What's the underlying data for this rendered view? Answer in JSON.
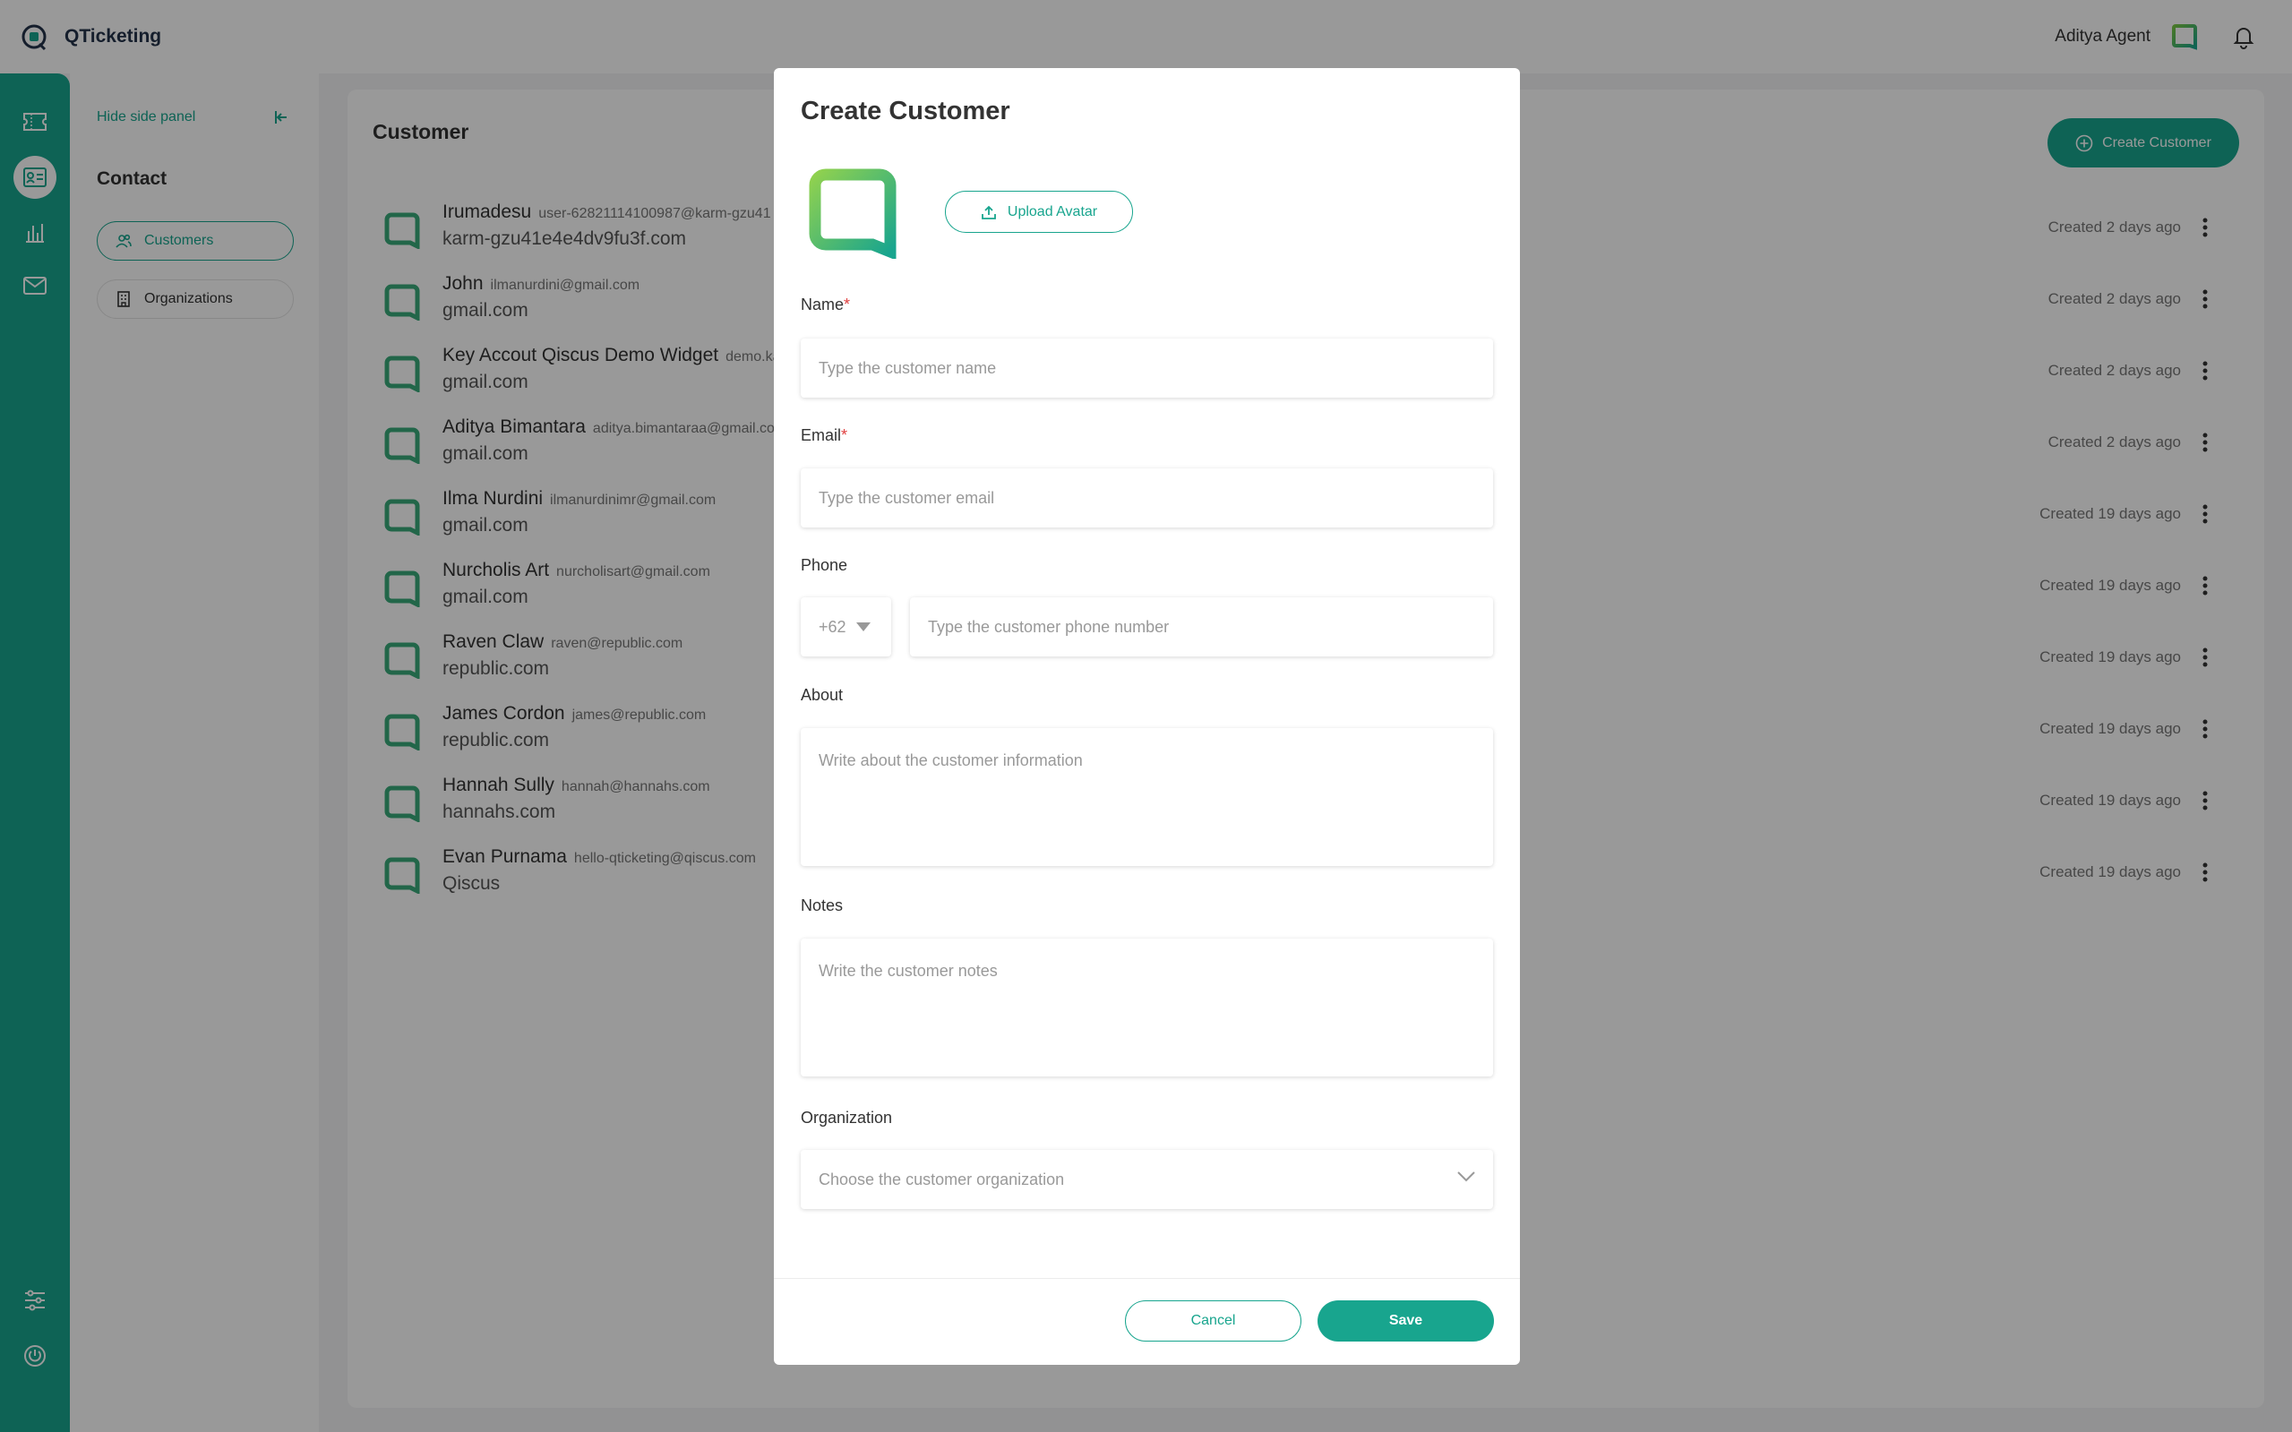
{
  "app": {
    "name": "QTicketing"
  },
  "header": {
    "agent_name": "Aditya Agent"
  },
  "sidepanel": {
    "hide_label": "Hide side panel",
    "section_title": "Contact",
    "items": [
      {
        "label": "Customers",
        "active": true
      },
      {
        "label": "Organizations",
        "active": false
      }
    ]
  },
  "main": {
    "title": "Customer",
    "create_button": "Create Customer",
    "customers": [
      {
        "name": "Irumadesu",
        "email": "user-62821114100987@karm-gzu41",
        "org": "karm-gzu41e4e4dv9fu3f.com",
        "created": "Created 2 days ago"
      },
      {
        "name": "John",
        "email": "ilmanurdini@gmail.com",
        "org": "gmail.com",
        "created": "Created 2 days ago"
      },
      {
        "name": "Key Accout Qiscus Demo Widget",
        "email": "demo.ka",
        "org": "gmail.com",
        "created": "Created 2 days ago"
      },
      {
        "name": "Aditya Bimantara",
        "email": "aditya.bimantaraa@gmail.co",
        "org": "gmail.com",
        "created": "Created 2 days ago"
      },
      {
        "name": "Ilma Nurdini",
        "email": "ilmanurdinimr@gmail.com",
        "org": "gmail.com",
        "created": "Created 19 days ago"
      },
      {
        "name": "Nurcholis Art",
        "email": "nurcholisart@gmail.com",
        "org": "gmail.com",
        "created": "Created 19 days ago"
      },
      {
        "name": "Raven Claw",
        "email": "raven@republic.com",
        "org": "republic.com",
        "created": "Created 19 days ago"
      },
      {
        "name": "James Cordon",
        "email": "james@republic.com",
        "org": "republic.com",
        "created": "Created 19 days ago"
      },
      {
        "name": "Hannah Sully",
        "email": "hannah@hannahs.com",
        "org": "hannahs.com",
        "created": "Created 19 days ago"
      },
      {
        "name": "Evan Purnama",
        "email": "hello-qticketing@qiscus.com",
        "org": "Qiscus",
        "created": "Created 19 days ago"
      }
    ]
  },
  "modal": {
    "title": "Create Customer",
    "upload_label": "Upload Avatar",
    "name_label": "Name",
    "name_placeholder": "Type the customer name",
    "email_label": "Email",
    "email_placeholder": "Type the customer email",
    "phone_label": "Phone",
    "phone_code": "+62",
    "phone_placeholder": "Type the customer phone number",
    "about_label": "About",
    "about_placeholder": "Write about the customer information",
    "notes_label": "Notes",
    "notes_placeholder": "Write the customer notes",
    "org_label": "Organization",
    "org_placeholder": "Choose the customer organization",
    "required_mark": "*",
    "cancel_label": "Cancel",
    "save_label": "Save"
  },
  "colors": {
    "brand": "#18a58e",
    "required": "#e04040",
    "overlay": "rgba(0,0,0,0.40)"
  },
  "icons": [
    "ticket-icon",
    "contact-card-icon",
    "chart-icon",
    "mail-icon",
    "sliders-icon",
    "power-icon",
    "bell-icon",
    "collapse-icon",
    "users-icon",
    "building-icon",
    "plus-circle-icon",
    "upload-icon",
    "kebab-icon",
    "chevron-down-icon",
    "caret-down-icon"
  ]
}
